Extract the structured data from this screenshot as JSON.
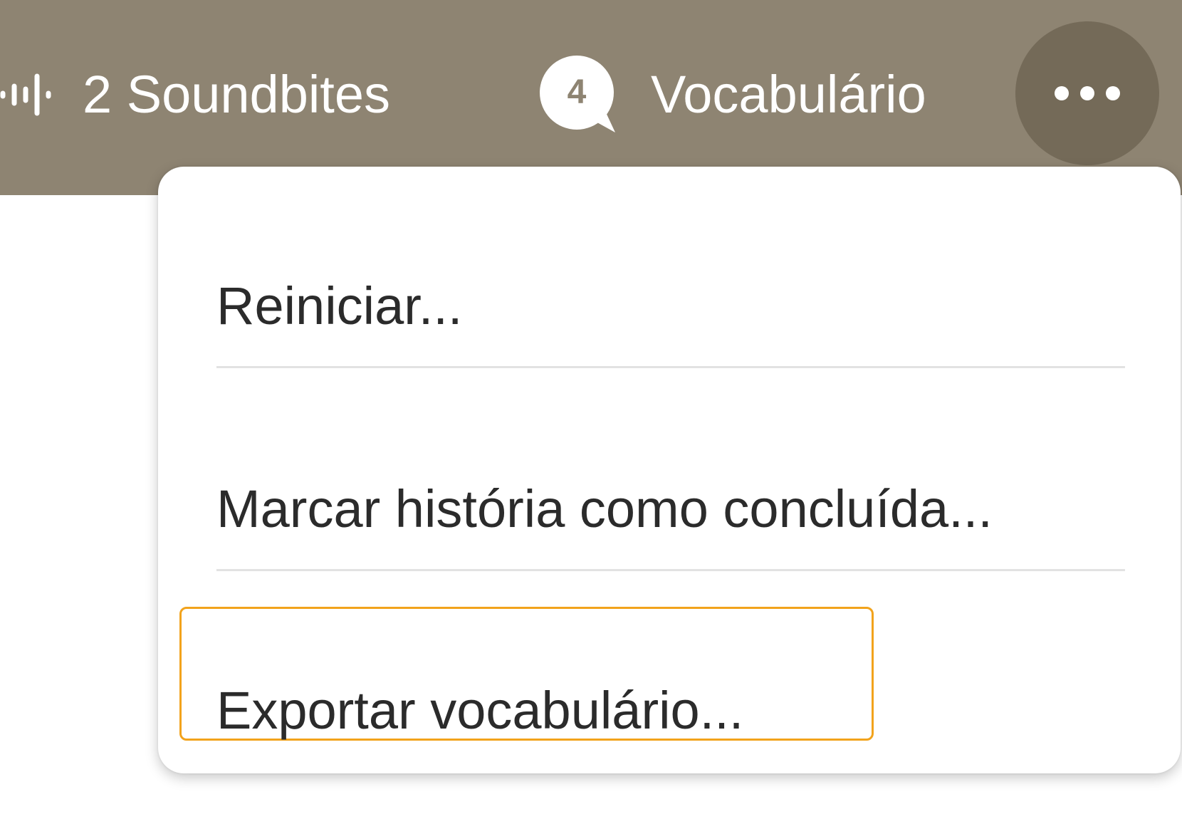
{
  "header": {
    "soundbites": {
      "label": "2 Soundbites",
      "icon": "waveform-icon"
    },
    "vocabulary": {
      "count": "4",
      "label": "Vocabulário",
      "icon": "speech-bubble-icon"
    },
    "more": {
      "icon": "more-horizontal-icon"
    }
  },
  "menu": {
    "items": [
      {
        "label": "Reiniciar..."
      },
      {
        "label": "Marcar história como concluída..."
      },
      {
        "label": "Exportar vocabulário..."
      }
    ],
    "focused_index": 2
  },
  "colors": {
    "header_bg": "#8e8472",
    "more_button_bg": "#746a58",
    "focus_ring": "#f2a31c",
    "menu_text": "#2b2b2b"
  }
}
